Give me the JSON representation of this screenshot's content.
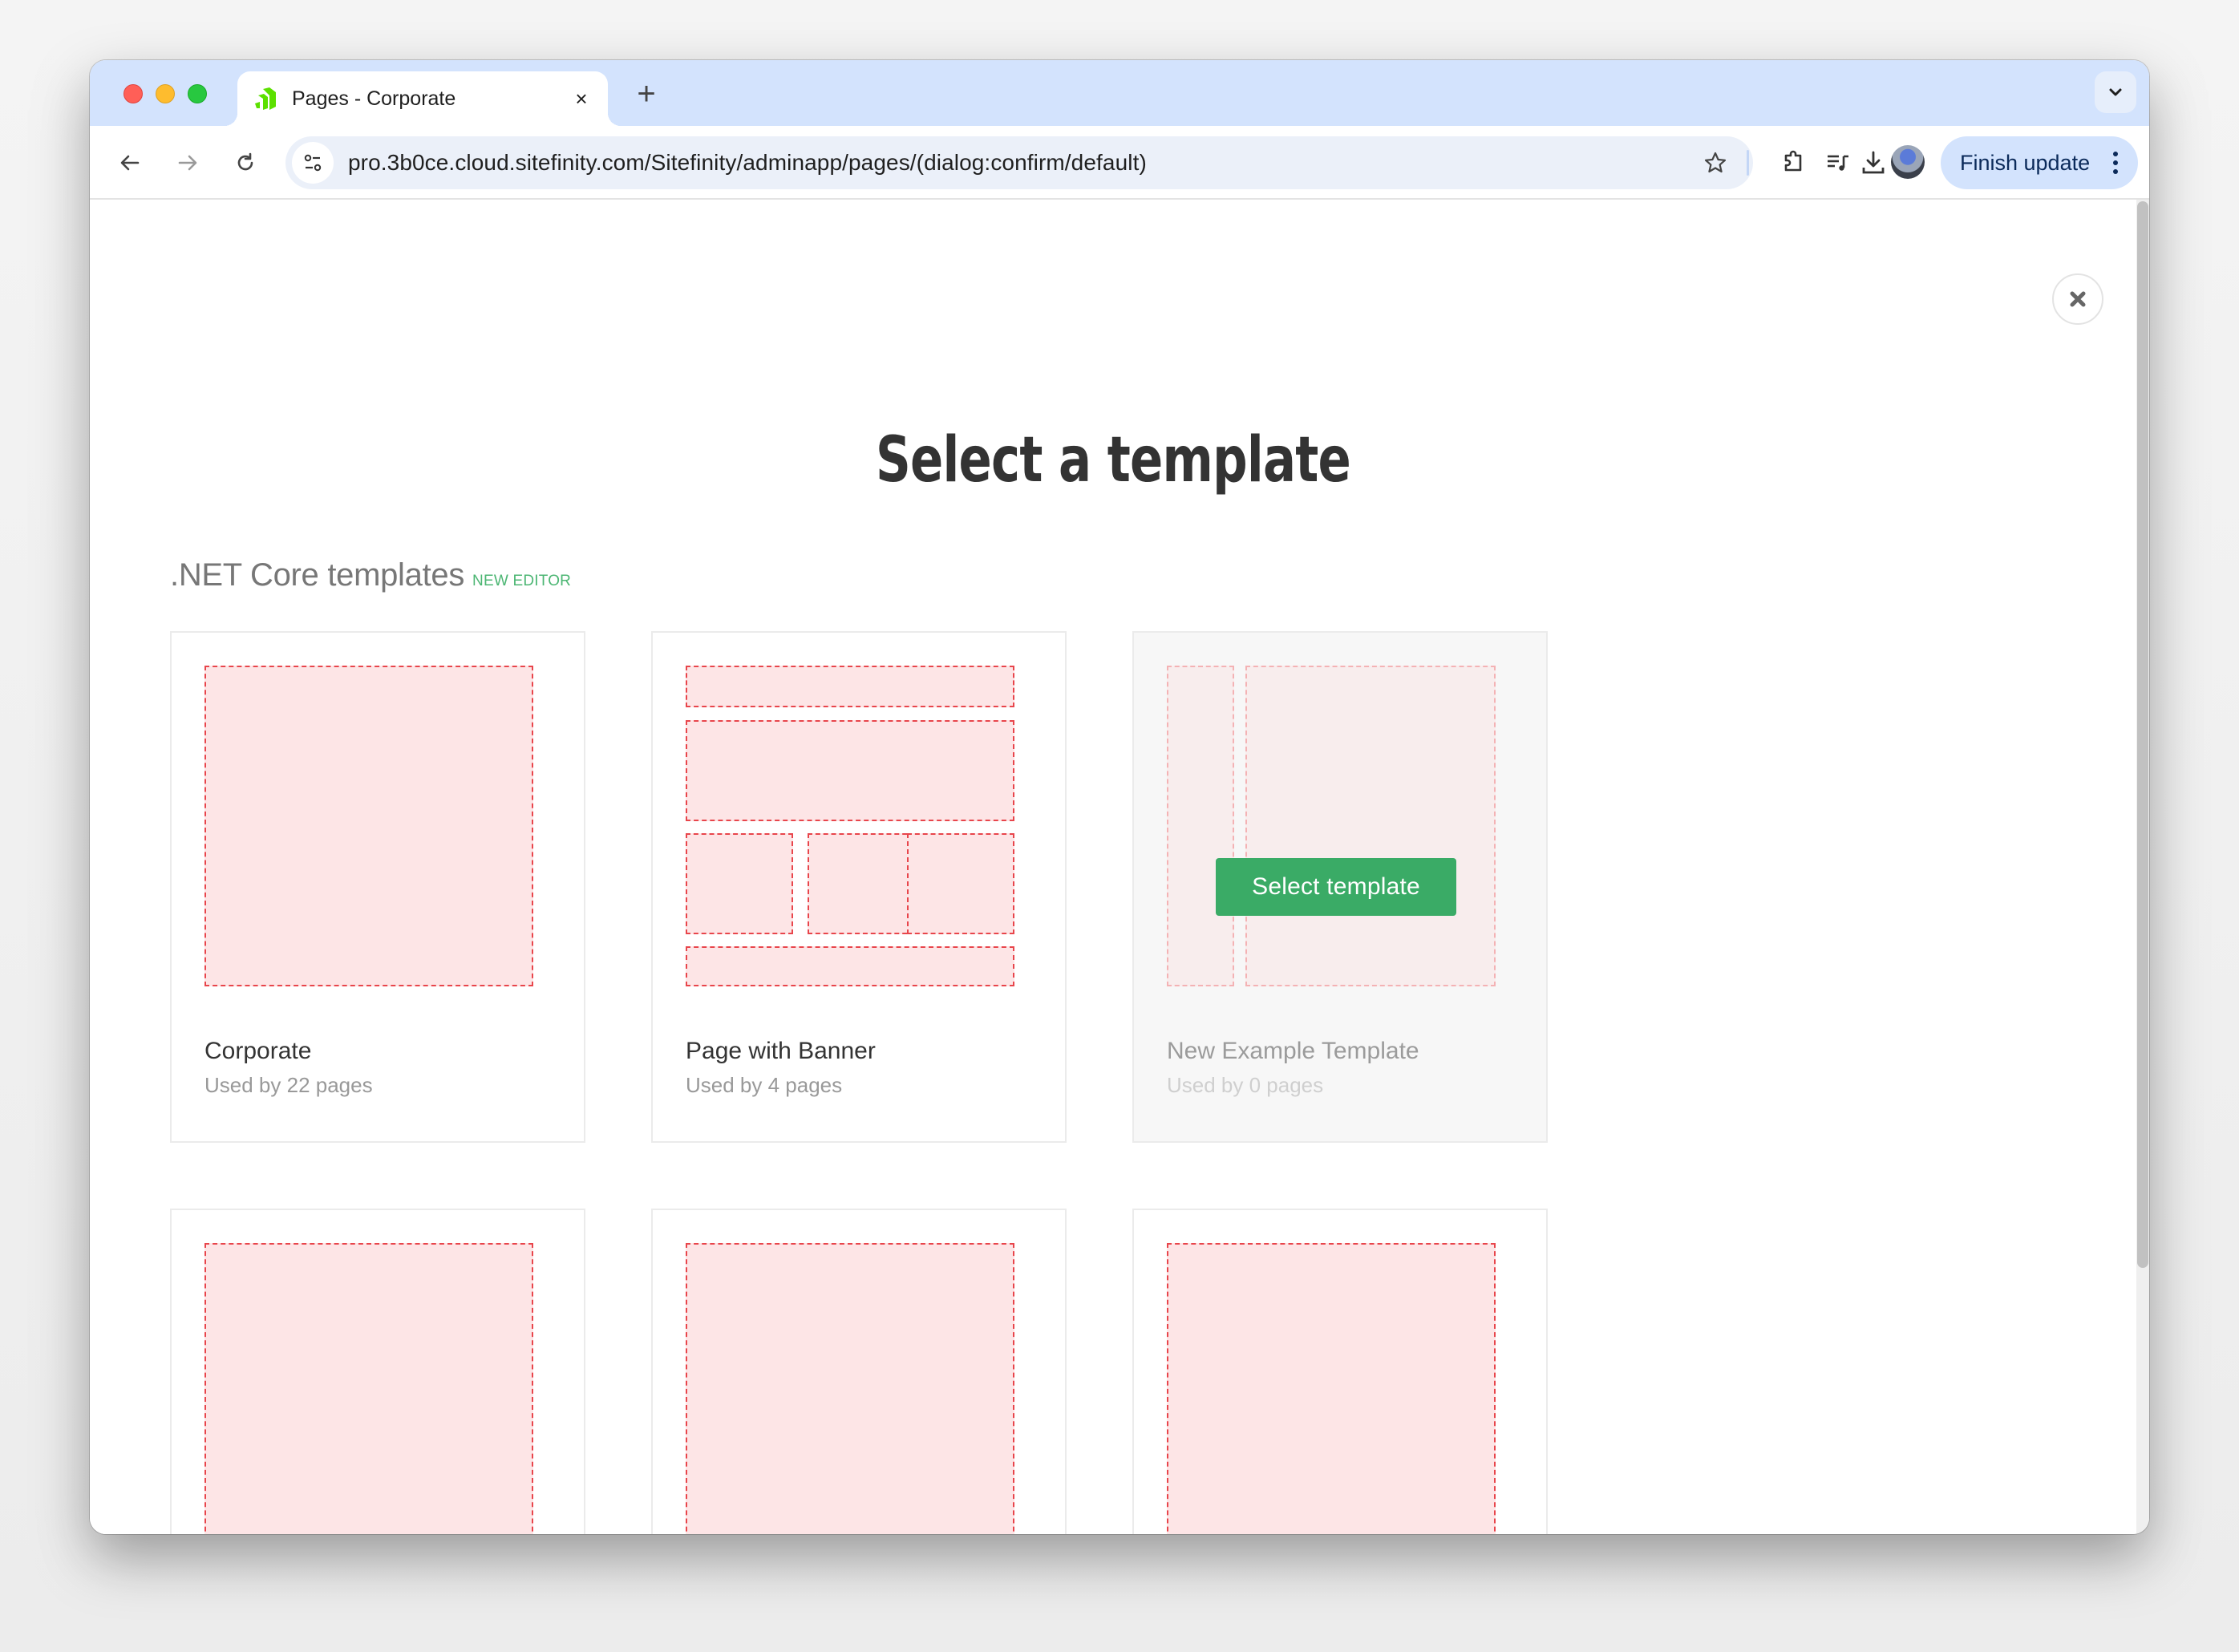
{
  "browser": {
    "tab": {
      "title": "Pages - Corporate",
      "favicon": "sitefinity-logo-icon",
      "close_icon": "×"
    },
    "new_tab_icon": "+",
    "tab_search_icon": "chevron-down-icon",
    "url": "pro.3b0ce.cloud.sitefinity.com/Sitefinity/adminapp/pages/(dialog:confirm/default)",
    "toolbar_icons": [
      "back-icon",
      "forward-icon",
      "reload-icon",
      "site-info-icon",
      "bookmark-star-icon",
      "extensions-icon",
      "media-controls-icon",
      "download-icon",
      "profile-avatar"
    ],
    "finish_update_label": "Finish update"
  },
  "dialog": {
    "title": "Select a template",
    "close_icon": "close-icon",
    "section": {
      "name": ".NET Core templates",
      "badge": "NEW EDITOR"
    },
    "templates": [
      {
        "name": "Corporate",
        "usage": "Used by 22 pages",
        "layout": "single",
        "hovered": false
      },
      {
        "name": "Page with Banner",
        "usage": "Used by 4 pages",
        "layout": "banner",
        "hovered": false
      },
      {
        "name": "New Example Template",
        "usage": "Used by 0 pages",
        "layout": "sidebar-left",
        "hovered": true,
        "action_label": "Select template"
      },
      {
        "name": "",
        "usage": "",
        "layout": "single",
        "hovered": false
      },
      {
        "name": "",
        "usage": "",
        "layout": "single",
        "hovered": false
      },
      {
        "name": "",
        "usage": "",
        "layout": "single",
        "hovered": false
      }
    ]
  },
  "colors": {
    "accent_green": "#3aab66",
    "badge_green": "#4cb673",
    "zone_fill": "#fde5e6",
    "zone_border": "#e8454b",
    "tabstrip": "#d3e3fd"
  }
}
